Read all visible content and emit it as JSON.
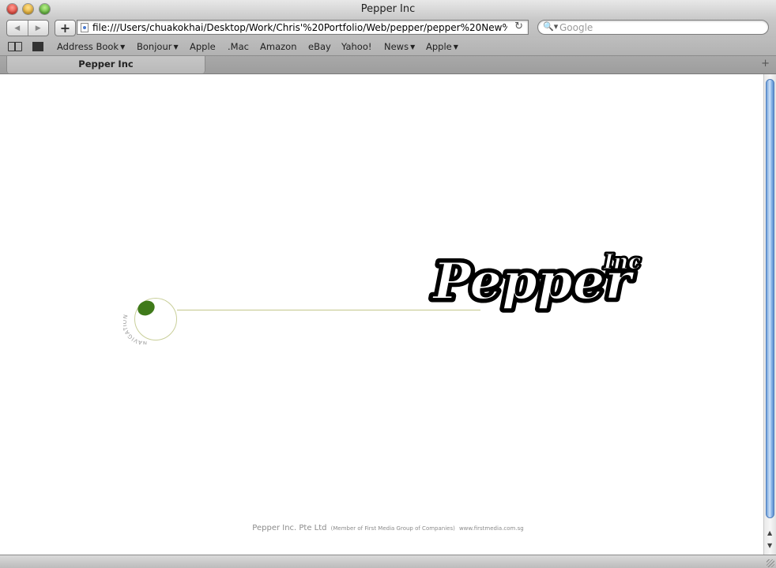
{
  "window": {
    "title": "Pepper Inc"
  },
  "toolbar": {
    "url": "file:///Users/chuakokhai/Desktop/Work/Chris'%20Portfolio/Web/pepper/pepper%20New%",
    "search_placeholder": "Google"
  },
  "bookmarks": [
    {
      "label": "Address Book",
      "menu": true
    },
    {
      "label": "Bonjour",
      "menu": true
    },
    {
      "label": "Apple",
      "menu": false
    },
    {
      "label": ".Mac",
      "menu": false
    },
    {
      "label": "Amazon",
      "menu": false
    },
    {
      "label": "eBay",
      "menu": false
    },
    {
      "label": "Yahoo!",
      "menu": false
    },
    {
      "label": "News",
      "menu": true
    },
    {
      "label": "Apple",
      "menu": true
    }
  ],
  "tabs": [
    {
      "label": "Pepper Inc"
    }
  ],
  "page": {
    "nav_label": "NAVIGATION",
    "logo": {
      "word": "Pepper",
      "suffix": "Inc"
    },
    "footer": {
      "company": "Pepper Inc. Pte Ltd",
      "member": "(Member of First Media Group of Companies)",
      "website": "www.firstmedia.com.sg"
    }
  },
  "colors": {
    "nav_accent": "#3f7a1a",
    "nav_line": "#c2c68a",
    "scroll_thumb": "#6e9fd9"
  }
}
